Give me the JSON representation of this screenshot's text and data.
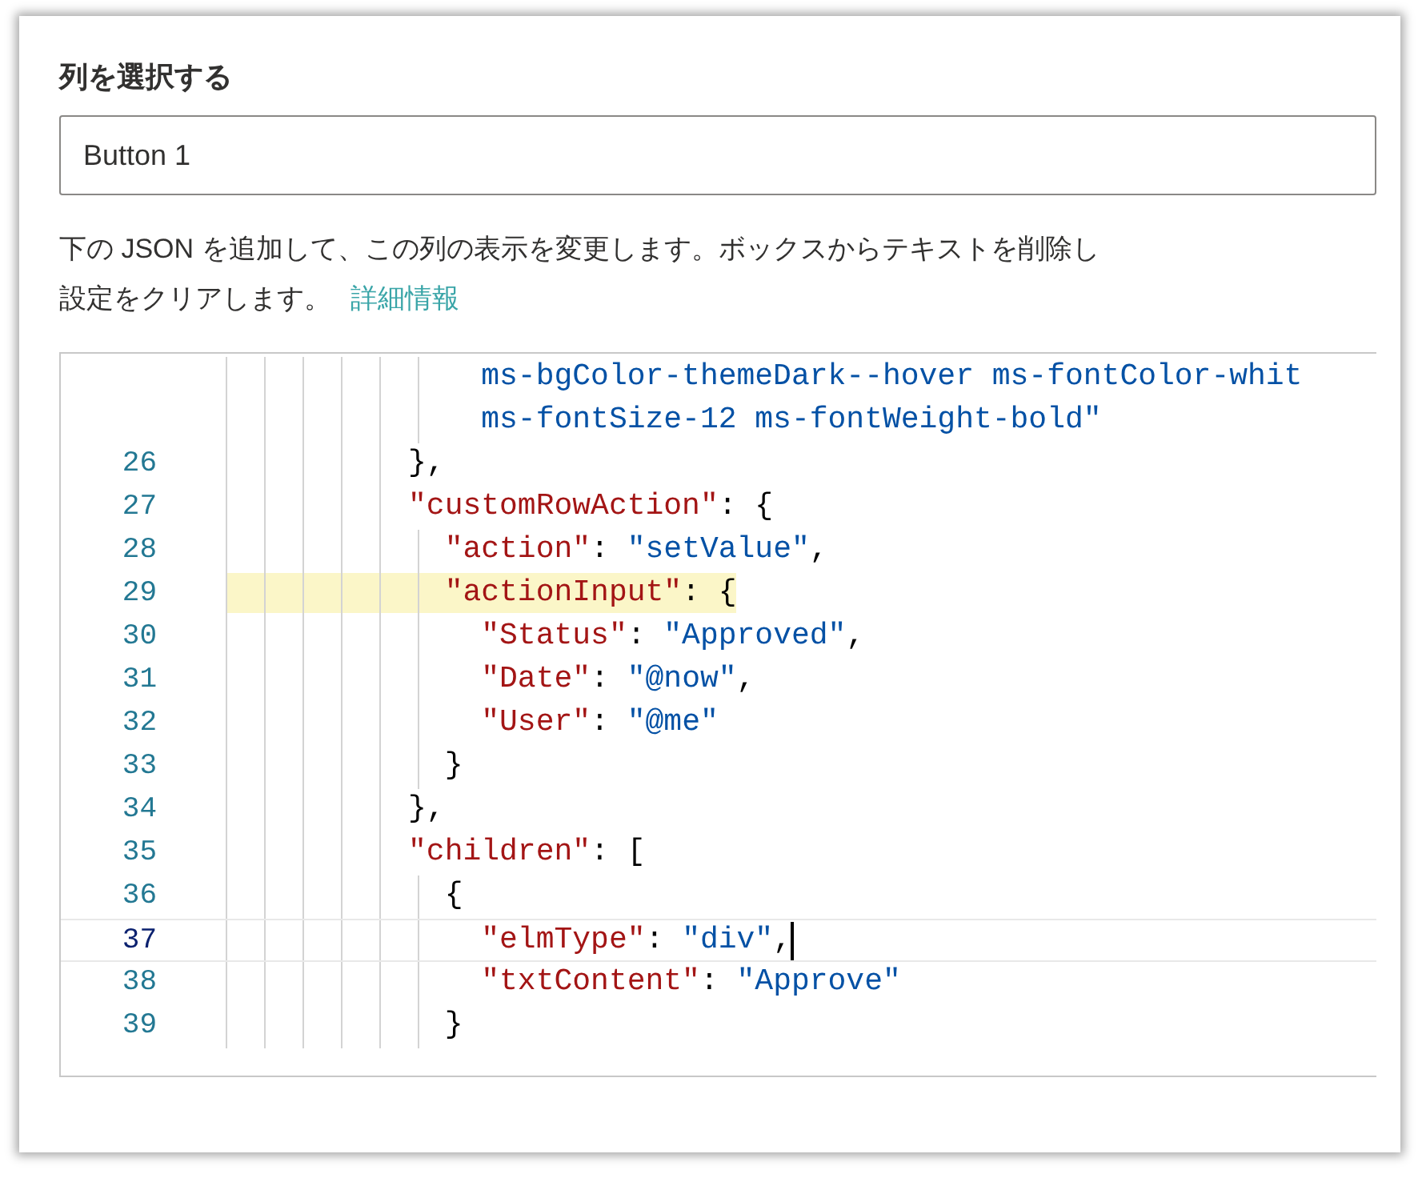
{
  "title": "列を選択する",
  "column_field": {
    "value": "Button 1"
  },
  "description": {
    "line_1": "下の JSON を追加して、この列の表示を変更します。ボックスからテキストを削除し",
    "line_2": "設定をクリアします。",
    "link": "詳細情報"
  },
  "editor": {
    "lines": [
      {
        "highlighted": false,
        "current": false,
        "tokens": [
          {
            "kind": "string",
            "text": "              ms-bgColor-themeDark--hover ms-fontColor-whit"
          }
        ]
      },
      {
        "highlighted": false,
        "current": false,
        "tokens": [
          {
            "kind": "string",
            "text": "              ms-fontSize-12 ms-fontWeight-bold\""
          }
        ]
      },
      {
        "number": "26",
        "highlighted": false,
        "current": false,
        "tokens": [
          {
            "kind": "punct",
            "text": "          },"
          }
        ]
      },
      {
        "number": "27",
        "highlighted": false,
        "current": false,
        "tokens": [
          {
            "kind": "key",
            "text": "          \"customRowAction\""
          },
          {
            "kind": "punct",
            "text": ": {"
          }
        ]
      },
      {
        "number": "28",
        "highlighted": false,
        "current": false,
        "tokens": [
          {
            "kind": "key",
            "text": "            \"action\""
          },
          {
            "kind": "punct",
            "text": ": "
          },
          {
            "kind": "string",
            "text": "\"setValue\""
          },
          {
            "kind": "punct",
            "text": ","
          }
        ]
      },
      {
        "number": "29",
        "highlighted": true,
        "current": false,
        "tokens": [
          {
            "kind": "key",
            "text": "            \"actionInput\""
          },
          {
            "kind": "punct",
            "text": ": {"
          }
        ]
      },
      {
        "number": "30",
        "highlighted": false,
        "current": false,
        "tokens": [
          {
            "kind": "key",
            "text": "              \"Status\""
          },
          {
            "kind": "punct",
            "text": ": "
          },
          {
            "kind": "string",
            "text": "\"Approved\""
          },
          {
            "kind": "punct",
            "text": ","
          }
        ]
      },
      {
        "number": "31",
        "highlighted": false,
        "current": false,
        "tokens": [
          {
            "kind": "key",
            "text": "              \"Date\""
          },
          {
            "kind": "punct",
            "text": ": "
          },
          {
            "kind": "string",
            "text": "\"@now\""
          },
          {
            "kind": "punct",
            "text": ","
          }
        ]
      },
      {
        "number": "32",
        "highlighted": false,
        "current": false,
        "tokens": [
          {
            "kind": "key",
            "text": "              \"User\""
          },
          {
            "kind": "punct",
            "text": ": "
          },
          {
            "kind": "string",
            "text": "\"@me\""
          }
        ]
      },
      {
        "number": "33",
        "highlighted": false,
        "current": false,
        "tokens": [
          {
            "kind": "punct",
            "text": "            }"
          }
        ]
      },
      {
        "number": "34",
        "highlighted": false,
        "current": false,
        "tokens": [
          {
            "kind": "punct",
            "text": "          },"
          }
        ]
      },
      {
        "number": "35",
        "highlighted": false,
        "current": false,
        "tokens": [
          {
            "kind": "key",
            "text": "          \"children\""
          },
          {
            "kind": "punct",
            "text": ": ["
          }
        ]
      },
      {
        "number": "36",
        "highlighted": false,
        "current": false,
        "tokens": [
          {
            "kind": "punct",
            "text": "            {"
          }
        ]
      },
      {
        "number": "37",
        "highlighted": false,
        "current": true,
        "tokens": [
          {
            "kind": "key",
            "text": "              \"elmType\""
          },
          {
            "kind": "punct",
            "text": ": "
          },
          {
            "kind": "string",
            "text": "\"div\""
          },
          {
            "kind": "punct",
            "text": ","
          }
        ]
      },
      {
        "number": "38",
        "highlighted": false,
        "current": false,
        "tokens": [
          {
            "kind": "key",
            "text": "              \"txtContent\""
          },
          {
            "kind": "punct",
            "text": ": "
          },
          {
            "kind": "string",
            "text": "\"Approve\""
          }
        ]
      },
      {
        "number": "39",
        "highlighted": false,
        "current": false,
        "tokens": [
          {
            "kind": "punct",
            "text": "            }"
          }
        ]
      }
    ]
  }
}
